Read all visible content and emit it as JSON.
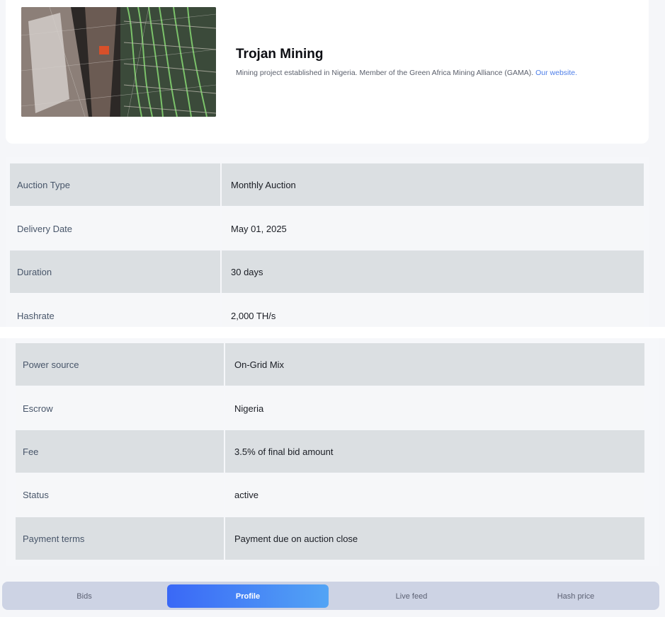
{
  "project": {
    "image_alt": "Mining facility racks with cabling",
    "title": "Trojan Mining",
    "description": "Mining project established in Nigeria. Member of the Green Africa Mining Alliance (GAMA).",
    "website_link": "Our website."
  },
  "details": [
    {
      "key": "Auction Type",
      "value": "Monthly Auction"
    },
    {
      "key": "Delivery Date",
      "value": "May 01, 2025"
    },
    {
      "key": "Duration",
      "value": "30 days"
    },
    {
      "key": "Hashrate",
      "value": "2,000 TH/s"
    },
    {
      "key": "Power source",
      "value": "On-Grid Mix"
    },
    {
      "key": "Escrow",
      "value": "Nigeria"
    },
    {
      "key": "Fee",
      "value": "3.5% of final bid amount"
    },
    {
      "key": "Status",
      "value": "active"
    },
    {
      "key": "Payment terms",
      "value": "Payment due on auction close"
    }
  ],
  "tabs": [
    {
      "label": "Bids",
      "active": false
    },
    {
      "label": "Profile",
      "active": true
    },
    {
      "label": "Live feed",
      "active": false
    },
    {
      "label": "Hash price",
      "active": false
    }
  ],
  "colors": {
    "accent_start": "#3a68f6",
    "accent_end": "#53a4f5",
    "link": "#4d7ee8",
    "row_shaded": "#dbdfe2"
  }
}
